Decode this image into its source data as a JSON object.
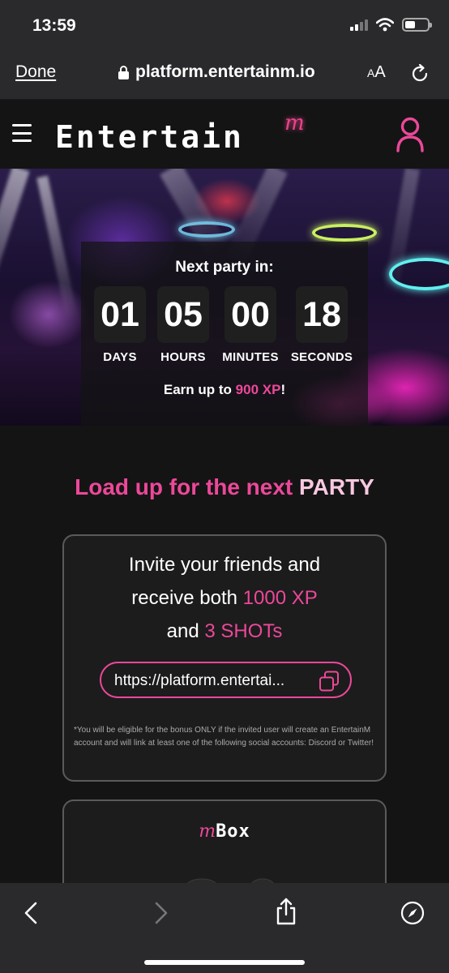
{
  "status_bar": {
    "time": "13:59"
  },
  "browser": {
    "done_label": "Done",
    "url": "platform.entertainm.io",
    "text_size_label_small": "A",
    "text_size_label_large": "A"
  },
  "header": {
    "logo_word": "Entertain",
    "logo_mark": "m"
  },
  "hero": {
    "countdown_title": "Next party in:",
    "units": [
      {
        "value": "01",
        "label": "DAYS"
      },
      {
        "value": "05",
        "label": "HOURS"
      },
      {
        "value": "00",
        "label": "MINUTES"
      },
      {
        "value": "18",
        "label": "SECONDS"
      }
    ],
    "earn_prefix": "Earn up to ",
    "earn_amount": "900 XP",
    "earn_suffix": "!"
  },
  "section": {
    "title_part1": "Load up for the next ",
    "title_part2": "PARTY"
  },
  "invite": {
    "line1": "Invite your friends and",
    "line2_prefix": "receive both ",
    "line2_highlight": "1000 XP",
    "line3_prefix": "and ",
    "line3_highlight": "3 SHOTs",
    "link_value": "https://platform.entertai...",
    "disclaimer": "*You will be eligible for the bonus ONLY if the invited user will create an EntertainM account and will link at least one of the following social accounts: Discord or Twitter!"
  },
  "mbox": {
    "logo_mark": "m",
    "logo_word": "Box"
  },
  "colors": {
    "accent": "#ec4899",
    "background": "#141414",
    "card": "#1c1c1c"
  }
}
